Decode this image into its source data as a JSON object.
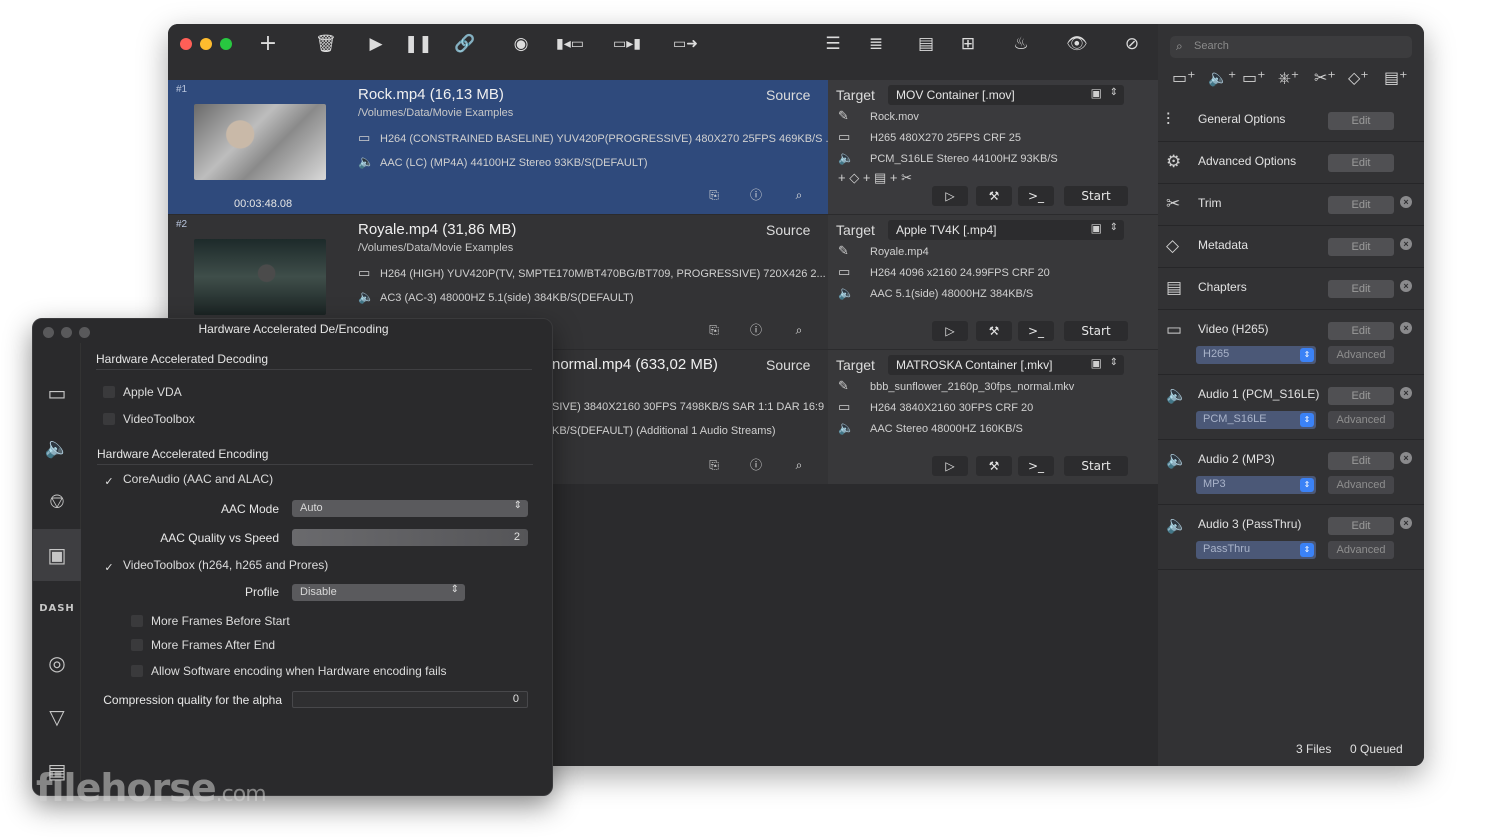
{
  "toolbar": {
    "icons": [
      "add-icon",
      "trash-icon",
      "play-icon",
      "pause-icon",
      "link-icon",
      "disc-icon",
      "video-to-image-icon",
      "image-to-video-icon",
      "subtitle-export-icon",
      "list-compact-icon",
      "list-detail-icon",
      "layout-rows-icon",
      "grid-icon",
      "burn-icon",
      "eye-icon",
      "disable-icon"
    ],
    "colors": {
      "close": "#ff5f57",
      "minimize": "#febc2e",
      "zoom": "#28c840"
    }
  },
  "jobs": [
    {
      "num": "#1",
      "file": "Rock.mp4  (16,13 MB)",
      "path": "/Volumes/Data/Movie Examples",
      "video": "H264 (CONSTRAINED BASELINE) YUV420P(PROGRESSIVE) 480X270  25FPS 469KB/S ...",
      "audio": "AAC (LC) (MP4A) 44100HZ Stereo 93KB/S(DEFAULT)",
      "duration": "00:03:48.08",
      "source_label": "Source",
      "target_label": "Target",
      "target": "MOV Container [.mov]",
      "out_name": "Rock.mov",
      "out_video": "H265 480X270 25FPS CRF 25",
      "out_audio": "PCM_S16LE Stereo 44100HZ 93KB/S",
      "start": "Start"
    },
    {
      "num": "#2",
      "file": "Royale.mp4  (31,86 MB)",
      "path": "/Volumes/Data/Movie Examples",
      "video": "H264 (HIGH) YUV420P(TV, SMPTE170M/BT470BG/BT709, PROGRESSIVE) 720X426  2...",
      "audio": "AC3 (AC-3) 48000HZ 5.1(side) 384KB/S(DEFAULT)",
      "source_label": "Source",
      "target_label": "Target",
      "target": "Apple TV4K [.mp4]",
      "out_name": "Royale.mp4",
      "out_video": "H264 4096 x2160  24.99FPS CRF 20",
      "out_audio": "AAC 5.1(side) 48000HZ 384KB/S",
      "start": "Start"
    },
    {
      "file": "normal.mp4  (633,02 MB)",
      "video": "SIVE) 3840X2160  30FPS 7498KB/S SAR 1:1 DAR 16:9",
      "audio": "KB/S(DEFAULT) (Additional 1 Audio Streams)",
      "source_label": "Source",
      "target_label": "Target",
      "target": "MATROSKA Container [.mkv]",
      "out_name": "bbb_sunflower_2160p_30fps_normal.mkv",
      "out_video": "H264 3840X2160 30FPS CRF 20",
      "out_audio": "AAC Stereo 48000HZ 160KB/S",
      "start": "Start"
    }
  ],
  "inspector": {
    "search_placeholder": "Search",
    "edit": "Edit",
    "advanced": "Advanced",
    "rows": [
      {
        "label": "General Options"
      },
      {
        "label": "Advanced Options"
      },
      {
        "label": "Trim"
      },
      {
        "label": "Metadata"
      },
      {
        "label": "Chapters"
      },
      {
        "label": "Video (H265)",
        "select": "H265"
      },
      {
        "label": "Audio 1 (PCM_S16LE)",
        "select": "PCM_S16LE"
      },
      {
        "label": "Audio 2 (MP3)",
        "select": "MP3"
      },
      {
        "label": "Audio 3 (PassThru)",
        "select": "PassThru"
      }
    ],
    "files": "3 Files",
    "queued": "0 Queued"
  },
  "panel": {
    "title": "Hardware Accelerated De/Encoding",
    "decoding_heading": "Hardware Accelerated Decoding",
    "apple_vda": "Apple VDA",
    "videotoolbox": "VideoToolbox",
    "encoding_heading": "Hardware Accelerated Encoding",
    "coreaudio": "CoreAudio (AAC and ALAC)",
    "aac_mode_label": "AAC Mode",
    "aac_mode_value": "Auto",
    "aac_quality_label": "AAC Quality vs Speed",
    "aac_quality_value": "2",
    "vt_encode": "VideoToolbox (h264, h265 and Prores)",
    "profile_label": "Profile",
    "profile_value": "Disable",
    "more_before": "More Frames Before Start",
    "more_after": "More Frames After End",
    "allow_sw": "Allow Software encoding when Hardware encoding fails",
    "alpha_label": "Compression quality for the alpha",
    "alpha_value": "0",
    "dash_label": "DASH"
  },
  "watermark": {
    "name": "filehorse",
    "tld": ".com"
  }
}
